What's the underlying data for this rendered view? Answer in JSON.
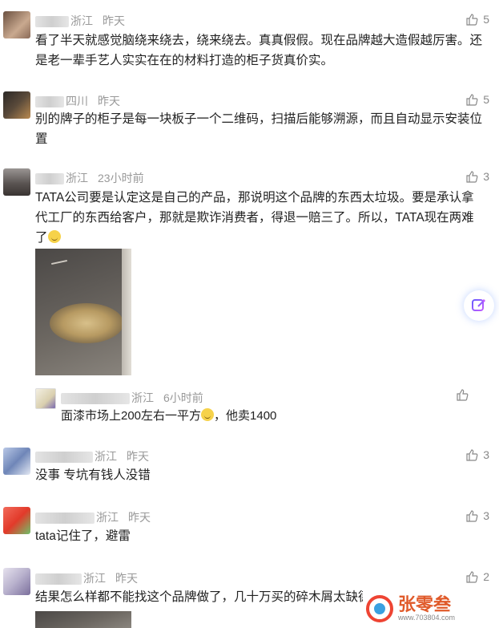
{
  "comments": [
    {
      "name_partial": "周∙",
      "location": "浙江",
      "time": "昨天",
      "likes": "5",
      "text": "看了半天就感觉脑绕来绕去，绕来绕去。真真假假。现在品牌越大造假越厉害。还是老一辈手艺人实实在在的材料打造的柜子货真价实。"
    },
    {
      "name_partial": "月",
      "location": "四川",
      "time": "昨天",
      "likes": "5",
      "text": "别的牌子的柜子是每一块板子一个二维码，扫描后能够溯源，而且自动显示安装位置"
    },
    {
      "name_partial": "",
      "location": "浙江",
      "time": "23小时前",
      "likes": "3",
      "text": "TATA公司要是认定这是自己的产品，那说明这个品牌的东西太垃圾。要是承认拿代工厂的东西给客户，那就是欺诈消费者，得退一赔三了。所以，TATA现在两难了"
    },
    {
      "name_partial": "",
      "location": "浙江",
      "time": "昨天",
      "likes": "3",
      "text": "没事 专坑有钱人没错"
    },
    {
      "name_partial": "",
      "location": "浙江",
      "time": "昨天",
      "likes": "3",
      "text": "tata记住了，避雷"
    },
    {
      "name_partial": "林",
      "location": "浙江",
      "time": "昨天",
      "likes": "2",
      "text": "结果怎么样都不能找这个品牌做了，几十万买的碎木屑太缺德了"
    }
  ],
  "reply": {
    "location": "浙江",
    "time": "6小时前",
    "text_before": "面漆市场上200左右一平方",
    "text_after": "，他卖1400"
  },
  "watermark": {
    "name": "张零叁",
    "url": "www.703804.com"
  },
  "colors": {
    "meta": "#999999",
    "accent": "#e05a2a"
  },
  "icons": {
    "like": "thumbs-up-icon",
    "fab": "ai-chat-icon"
  }
}
